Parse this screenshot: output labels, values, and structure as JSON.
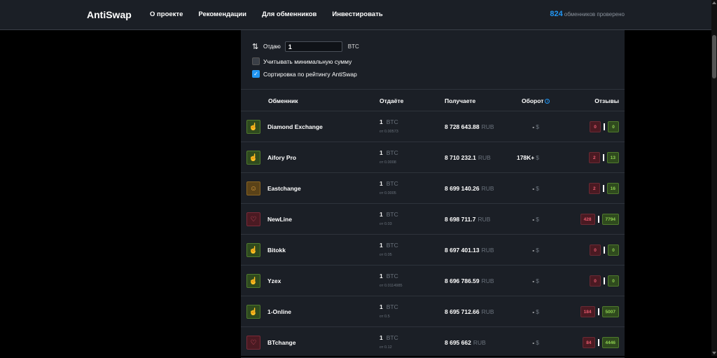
{
  "header": {
    "brand": "AntiSwap",
    "nav": [
      "О проекте",
      "Рекомендации",
      "Для обменников",
      "Инвестировать"
    ],
    "checked_count": "824",
    "checked_label": "обменников проверено"
  },
  "controls": {
    "give_label": "Отдаю",
    "give_value": "1",
    "give_currency": "BTC",
    "min_sum_label": "Учитывать минимальную сумму",
    "min_sum_checked": false,
    "sort_label": "Сортировка по рейтингу AntiSwap",
    "sort_checked": true
  },
  "table": {
    "headers": {
      "exchanger": "Обменник",
      "give": "Отдаёте",
      "get": "Получаете",
      "turnover": "Оборот",
      "reviews": "Отзывы"
    },
    "rows": [
      {
        "status": "good",
        "name": "Diamond Exchange",
        "give": "1",
        "give_cur": "BTC",
        "min": "от 0.00573",
        "get": "8 728 643.88",
        "get_cur": "RUB",
        "turnover": "-",
        "turnover_cur": "$",
        "neg": "0",
        "pos": "0"
      },
      {
        "status": "good",
        "name": "Aifory Pro",
        "give": "1",
        "give_cur": "BTC",
        "min": "от 0.0008",
        "get": "8 710 232.1",
        "get_cur": "RUB",
        "turnover": "178K+",
        "turnover_cur": "$",
        "neg": "2",
        "pos": "13"
      },
      {
        "status": "neutral",
        "name": "Eastchange",
        "give": "1",
        "give_cur": "BTC",
        "min": "от 0.0005",
        "get": "8 699 140.26",
        "get_cur": "RUB",
        "turnover": "-",
        "turnover_cur": "$",
        "neg": "2",
        "pos": "16"
      },
      {
        "status": "bad",
        "name": "NewLine",
        "give": "1",
        "give_cur": "BTC",
        "min": "от 0.03",
        "get": "8 698 711.7",
        "get_cur": "RUB",
        "turnover": "-",
        "turnover_cur": "$",
        "neg": "428",
        "pos": "7794"
      },
      {
        "status": "good",
        "name": "Bitokk",
        "give": "1",
        "give_cur": "BTC",
        "min": "от 0.05",
        "get": "8 697 401.13",
        "get_cur": "RUB",
        "turnover": "-",
        "turnover_cur": "$",
        "neg": "0",
        "pos": "0"
      },
      {
        "status": "good",
        "name": "Yzex",
        "give": "1",
        "give_cur": "BTC",
        "min": "от 0.0114985",
        "get": "8 696 786.59",
        "get_cur": "RUB",
        "turnover": "-",
        "turnover_cur": "$",
        "neg": "0",
        "pos": "0"
      },
      {
        "status": "good",
        "name": "1-Online",
        "give": "1",
        "give_cur": "BTC",
        "min": "от 0.5",
        "get": "8 695 712.66",
        "get_cur": "RUB",
        "turnover": "-",
        "turnover_cur": "$",
        "neg": "184",
        "pos": "5007"
      },
      {
        "status": "bad",
        "name": "BTchange",
        "give": "1",
        "give_cur": "BTC",
        "min": "от 0.12",
        "get": "8 695 662",
        "get_cur": "RUB",
        "turnover": "-",
        "turnover_cur": "$",
        "neg": "84",
        "pos": "4446"
      }
    ]
  },
  "colors": {
    "accent": "#2196f3",
    "good": "#8fd14f",
    "bad": "#e85a6e",
    "neutral": "#e6a23c"
  }
}
